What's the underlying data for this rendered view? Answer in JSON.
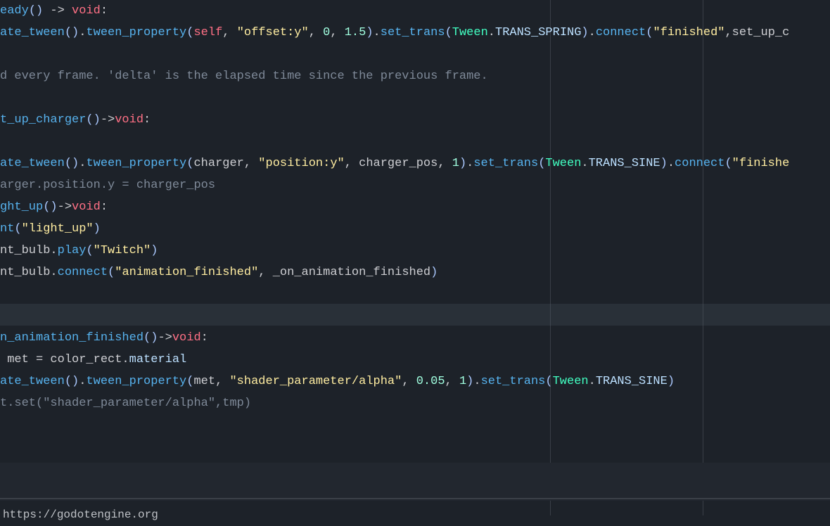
{
  "status_url": "https://godotengine.org",
  "lines": [
    [
      {
        "cls": "tk-func-name",
        "t": "eady"
      },
      {
        "cls": "tk-punct",
        "t": "()"
      },
      {
        "cls": "tk-default",
        "t": " -> "
      },
      {
        "cls": "tk-keyword",
        "t": "void"
      },
      {
        "cls": "tk-default",
        "t": ":"
      }
    ],
    [
      {
        "cls": "tk-func-name",
        "t": "ate_tween"
      },
      {
        "cls": "tk-punct",
        "t": "()"
      },
      {
        "cls": "tk-default",
        "t": "."
      },
      {
        "cls": "tk-func-name",
        "t": "tween_property"
      },
      {
        "cls": "tk-punct",
        "t": "("
      },
      {
        "cls": "tk-keyword",
        "t": "self"
      },
      {
        "cls": "tk-default",
        "t": ", "
      },
      {
        "cls": "tk-string",
        "t": "\"offset:y\""
      },
      {
        "cls": "tk-default",
        "t": ", "
      },
      {
        "cls": "tk-number",
        "t": "0"
      },
      {
        "cls": "tk-default",
        "t": ", "
      },
      {
        "cls": "tk-number",
        "t": "1.5"
      },
      {
        "cls": "tk-punct",
        "t": ")"
      },
      {
        "cls": "tk-default",
        "t": "."
      },
      {
        "cls": "tk-func-name",
        "t": "set_trans"
      },
      {
        "cls": "tk-punct",
        "t": "("
      },
      {
        "cls": "tk-type",
        "t": "Tween"
      },
      {
        "cls": "tk-default",
        "t": "."
      },
      {
        "cls": "tk-member",
        "t": "TRANS_SPRING"
      },
      {
        "cls": "tk-punct",
        "t": ")"
      },
      {
        "cls": "tk-default",
        "t": "."
      },
      {
        "cls": "tk-func-name",
        "t": "connect"
      },
      {
        "cls": "tk-punct",
        "t": "("
      },
      {
        "cls": "tk-string",
        "t": "\"finished\""
      },
      {
        "cls": "tk-default",
        "t": ",set_up_c"
      }
    ],
    [],
    [
      {
        "cls": "tk-comment",
        "t": "d every frame. 'delta' is the elapsed time since the previous frame."
      }
    ],
    [],
    [
      {
        "cls": "tk-func-name",
        "t": "t_up_charger"
      },
      {
        "cls": "tk-punct",
        "t": "()"
      },
      {
        "cls": "tk-default",
        "t": "->"
      },
      {
        "cls": "tk-keyword",
        "t": "void"
      },
      {
        "cls": "tk-default",
        "t": ":"
      }
    ],
    [],
    [
      {
        "cls": "tk-func-name",
        "t": "ate_tween"
      },
      {
        "cls": "tk-punct",
        "t": "()"
      },
      {
        "cls": "tk-default",
        "t": "."
      },
      {
        "cls": "tk-func-name",
        "t": "tween_property"
      },
      {
        "cls": "tk-punct",
        "t": "("
      },
      {
        "cls": "tk-default",
        "t": "charger, "
      },
      {
        "cls": "tk-string",
        "t": "\"position:y\""
      },
      {
        "cls": "tk-default",
        "t": ", charger_pos, "
      },
      {
        "cls": "tk-number",
        "t": "1"
      },
      {
        "cls": "tk-punct",
        "t": ")"
      },
      {
        "cls": "tk-default",
        "t": "."
      },
      {
        "cls": "tk-func-name",
        "t": "set_trans"
      },
      {
        "cls": "tk-punct",
        "t": "("
      },
      {
        "cls": "tk-type",
        "t": "Tween"
      },
      {
        "cls": "tk-default",
        "t": "."
      },
      {
        "cls": "tk-member",
        "t": "TRANS_SINE"
      },
      {
        "cls": "tk-punct",
        "t": ")"
      },
      {
        "cls": "tk-default",
        "t": "."
      },
      {
        "cls": "tk-func-name",
        "t": "connect"
      },
      {
        "cls": "tk-punct",
        "t": "("
      },
      {
        "cls": "tk-string",
        "t": "\"finishe"
      }
    ],
    [
      {
        "cls": "tk-comment",
        "t": "arger.position.y = charger_pos"
      }
    ],
    [
      {
        "cls": "tk-func-name",
        "t": "ght_up"
      },
      {
        "cls": "tk-punct",
        "t": "()"
      },
      {
        "cls": "tk-default",
        "t": "->"
      },
      {
        "cls": "tk-keyword",
        "t": "void"
      },
      {
        "cls": "tk-default",
        "t": ":"
      }
    ],
    [
      {
        "cls": "tk-func-name",
        "t": "nt"
      },
      {
        "cls": "tk-punct",
        "t": "("
      },
      {
        "cls": "tk-string",
        "t": "\"light_up\""
      },
      {
        "cls": "tk-punct",
        "t": ")"
      }
    ],
    [
      {
        "cls": "tk-default",
        "t": "nt_bulb."
      },
      {
        "cls": "tk-func-name",
        "t": "play"
      },
      {
        "cls": "tk-punct",
        "t": "("
      },
      {
        "cls": "tk-string",
        "t": "\"Twitch\""
      },
      {
        "cls": "tk-punct",
        "t": ")"
      }
    ],
    [
      {
        "cls": "tk-default",
        "t": "nt_bulb."
      },
      {
        "cls": "tk-func-name",
        "t": "connect"
      },
      {
        "cls": "tk-punct",
        "t": "("
      },
      {
        "cls": "tk-string",
        "t": "\"animation_finished\""
      },
      {
        "cls": "tk-default",
        "t": ", _on_animation_finished"
      },
      {
        "cls": "tk-punct",
        "t": ")"
      }
    ],
    [],
    [],
    [
      {
        "cls": "tk-func-name",
        "t": "n_animation_finished"
      },
      {
        "cls": "tk-punct",
        "t": "()"
      },
      {
        "cls": "tk-default",
        "t": "->"
      },
      {
        "cls": "tk-keyword",
        "t": "void"
      },
      {
        "cls": "tk-default",
        "t": ":"
      }
    ],
    [
      {
        "cls": "tk-default",
        "t": " met = color_rect."
      },
      {
        "cls": "tk-member",
        "t": "material"
      }
    ],
    [
      {
        "cls": "tk-func-name",
        "t": "ate_tween"
      },
      {
        "cls": "tk-punct",
        "t": "()"
      },
      {
        "cls": "tk-default",
        "t": "."
      },
      {
        "cls": "tk-func-name",
        "t": "tween_property"
      },
      {
        "cls": "tk-punct",
        "t": "("
      },
      {
        "cls": "tk-default",
        "t": "met, "
      },
      {
        "cls": "tk-string",
        "t": "\"shader_parameter/alpha\""
      },
      {
        "cls": "tk-default",
        "t": ", "
      },
      {
        "cls": "tk-number",
        "t": "0.05"
      },
      {
        "cls": "tk-default",
        "t": ", "
      },
      {
        "cls": "tk-number",
        "t": "1"
      },
      {
        "cls": "tk-punct",
        "t": ")"
      },
      {
        "cls": "tk-default",
        "t": "."
      },
      {
        "cls": "tk-func-name",
        "t": "set_trans"
      },
      {
        "cls": "tk-punct",
        "t": "("
      },
      {
        "cls": "tk-type",
        "t": "Tween"
      },
      {
        "cls": "tk-default",
        "t": "."
      },
      {
        "cls": "tk-member",
        "t": "TRANS_SINE"
      },
      {
        "cls": "tk-punct",
        "t": ")"
      }
    ],
    [
      {
        "cls": "tk-comment",
        "t": "t.set(\"shader_parameter/alpha\",tmp)"
      }
    ]
  ]
}
